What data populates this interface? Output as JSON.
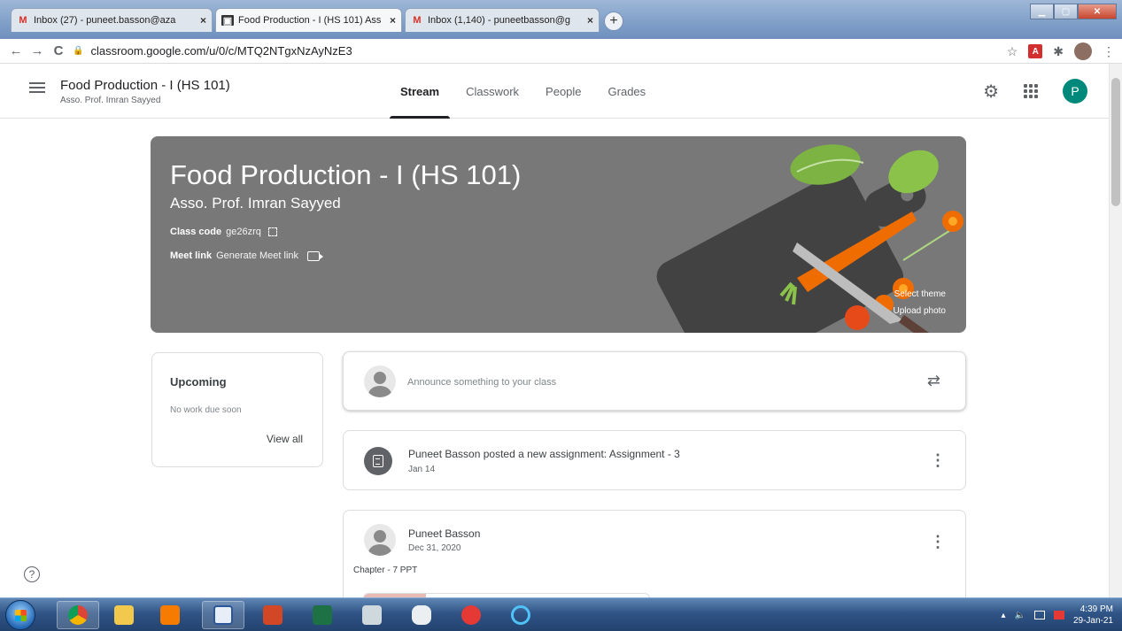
{
  "browser": {
    "tabs": [
      {
        "favicon": "gmail-icon",
        "title": "Inbox (27) - puneet.basson@aza",
        "active": false
      },
      {
        "favicon": "classroom-icon",
        "title": "Food Production - I (HS 101) Ass",
        "active": true
      },
      {
        "favicon": "gmail-icon",
        "title": "Inbox (1,140) - puneetbasson@g",
        "active": false
      }
    ],
    "new_tab_symbol": "+",
    "close_symbol": "×",
    "url": "classroom.google.com/u/0/c/MTQ2NTgxNzAyNzE3",
    "back_symbol": "←",
    "forward_symbol": "→",
    "reload_symbol": "C",
    "bookmark_symbol": "☆",
    "extension_symbol": "✱",
    "menu_symbol": "⋮",
    "pdf_symbol": "A"
  },
  "header": {
    "class_title": "Food Production - I (HS 101)",
    "class_subtitle": "Asso. Prof. Imran Sayyed",
    "tabs": [
      "Stream",
      "Classwork",
      "People",
      "Grades"
    ],
    "active_tab": "Stream",
    "avatar_letter": "P",
    "gear_symbol": "⚙"
  },
  "banner": {
    "title": "Food Production - I (HS 101)",
    "teacher": "Asso. Prof. Imran Sayyed",
    "class_code_label": "Class code",
    "class_code": "ge26zrq",
    "meet_label": "Meet link",
    "meet_action": "Generate Meet link",
    "select_theme": "Select theme",
    "upload_photo": "Upload photo",
    "bg_color": "#787878"
  },
  "upcoming": {
    "title": "Upcoming",
    "subtitle": "No work due soon",
    "view_all": "View all"
  },
  "stream": {
    "announce_placeholder": "Announce something to your class",
    "repost_symbol": "⇄",
    "kebab_symbol": "⋮",
    "posts": [
      {
        "text": "Puneet Basson posted a new assignment: Assignment - 3",
        "date": "Jan 14"
      },
      {
        "author": "Puneet Basson",
        "date": "Dec 31, 2020",
        "body": "Chapter - 7 PPT"
      }
    ]
  },
  "help_symbol": "?",
  "taskbar": {
    "clock_time": "4:39 PM",
    "clock_date": "29-Jan-21",
    "tray_symbols": [
      "▴",
      "🔈"
    ]
  },
  "colors": {
    "avatar": "#00897b",
    "active_tab_underline": "#202124"
  }
}
